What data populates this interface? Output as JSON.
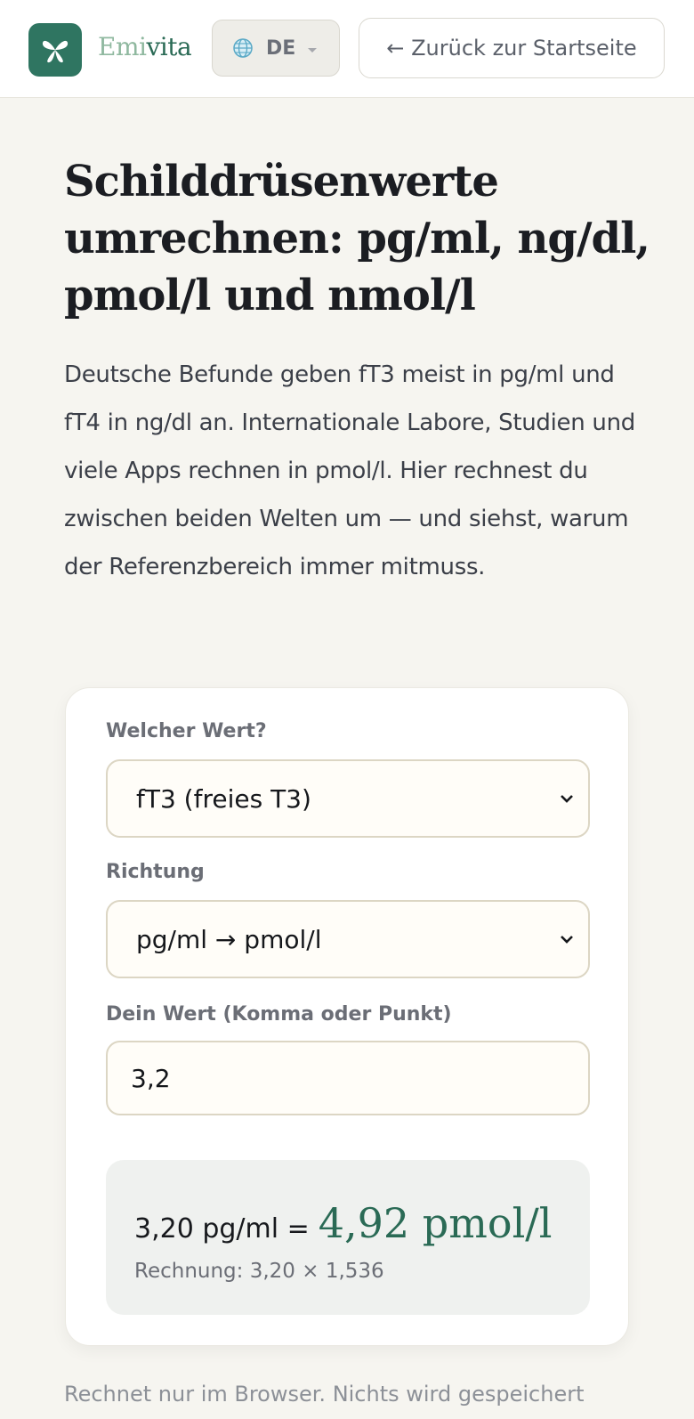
{
  "header": {
    "brand_a": "Emi",
    "brand_b": "vita",
    "language": "DE",
    "back_label": "← Zurück zur Startseite"
  },
  "title": "Schilddrüsenwerte umrechnen: pg/ml, ng/dl, pmol/l und nmol/l",
  "intro": "Deutsche Befunde geben fT3 meist in pg/ml und fT4 in ng/dl an. Internationale Labore, Studien und viele Apps rechnen in pmol/l. Hier rechnest du zwischen beiden Welten um — und siehst, warum der Referenzbereich immer mitmuss.",
  "form": {
    "value_label": "Welcher Wert?",
    "value_selected": "fT3 (freies T3)",
    "direction_label": "Richtung",
    "direction_selected": "pg/ml → pmol/l",
    "input_label": "Dein Wert (Komma oder Punkt)",
    "input_value": "3,2"
  },
  "result": {
    "equation": "3,20 pg/ml =",
    "value": "4,92 pmol/l",
    "calculation": "Rechnung: 3,20 × 1,536"
  },
  "footnote": "Rechnet nur im Browser. Nichts wird gespeichert",
  "colors": {
    "accent": "#2a6a55",
    "logo_bg": "#2f7561",
    "page_bg": "#f6f5f0"
  }
}
